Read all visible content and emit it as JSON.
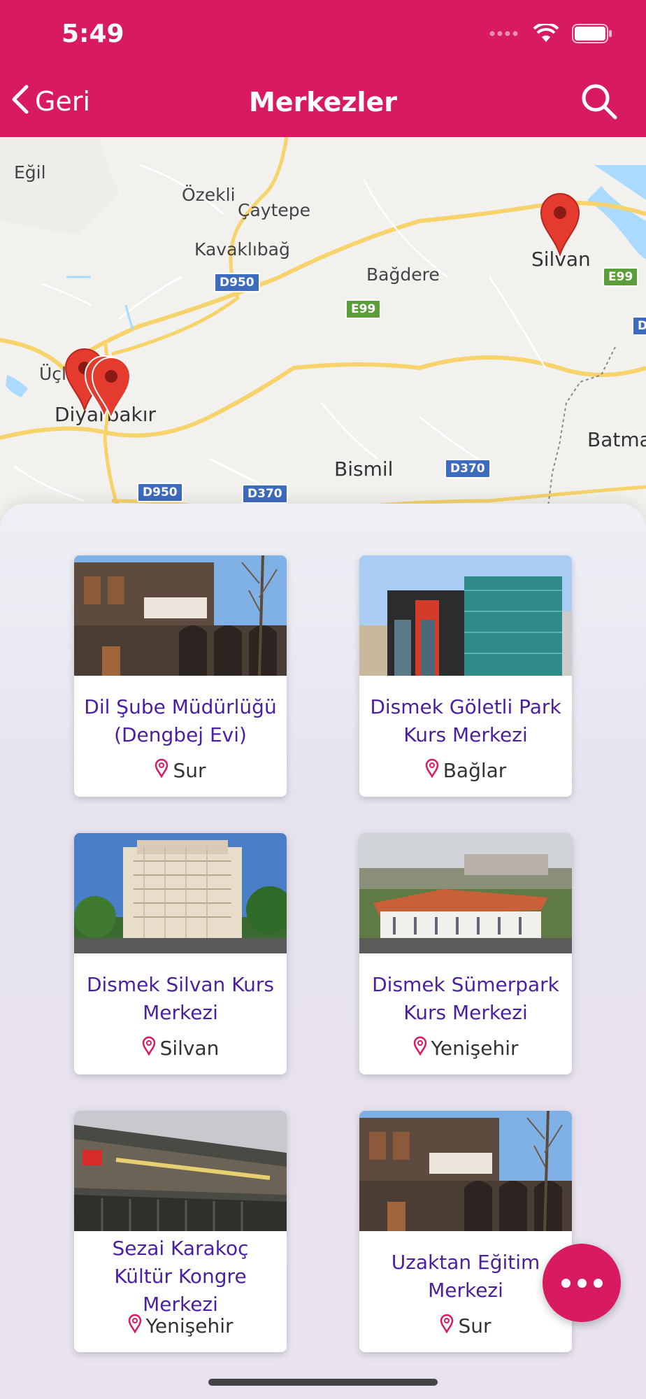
{
  "status_bar": {
    "time": "5:49"
  },
  "nav": {
    "back_label": "Geri",
    "title": "Merkezler"
  },
  "map": {
    "labels": {
      "egil": "Eğil",
      "ozekli": "Özekli",
      "caytepe": "Çaytepe",
      "kavaklibag": "Kavaklıbağ",
      "bagdere": "Bağdere",
      "silvan": "Silvan",
      "uc": "Üçl",
      "diyarbakir": "Diyarbakır",
      "bismil": "Bismil",
      "batman": "Batma"
    },
    "shields": {
      "d950a": "D950",
      "e99a": "E99",
      "e99b": "E99",
      "d950b": "D950",
      "d370a": "D370",
      "d370b": "D370",
      "d_edge": "D"
    }
  },
  "centers": [
    {
      "title": "Dil Şube Müdürlüğü (Dengbej Evi)",
      "location": "Sur"
    },
    {
      "title": "Dismek Göletli Park Kurs Merkezi",
      "location": "Bağlar"
    },
    {
      "title": "Dismek Silvan Kurs Merkezi",
      "location": "Silvan"
    },
    {
      "title": "Dismek Sümerpark Kurs Merkezi",
      "location": "Yenişehir"
    },
    {
      "title": "Sezai Karakoç Kültür Kongre Merkezi",
      "location": "Yenişehir"
    },
    {
      "title": "Uzaktan Eğitim Merkezi",
      "location": "Sur"
    }
  ],
  "colors": {
    "accent": "#d81b60",
    "title_text": "#4a1fa0"
  }
}
